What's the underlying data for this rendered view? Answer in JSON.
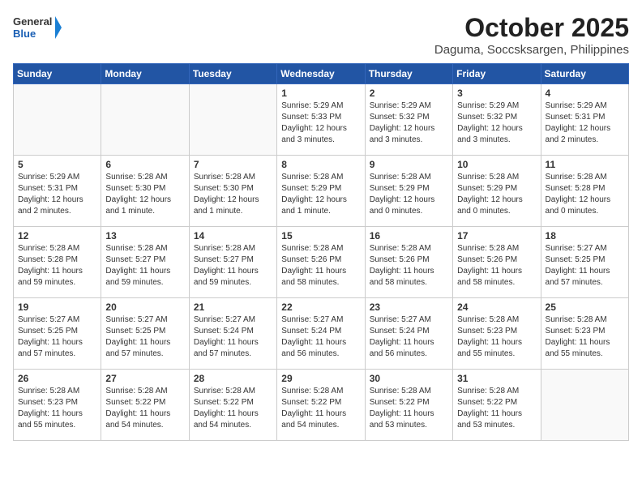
{
  "logo": {
    "text_general": "General",
    "text_blue": "Blue"
  },
  "header": {
    "month": "October 2025",
    "location": "Daguma, Soccsksargen, Philippines"
  },
  "weekdays": [
    "Sunday",
    "Monday",
    "Tuesday",
    "Wednesday",
    "Thursday",
    "Friday",
    "Saturday"
  ],
  "weeks": [
    [
      {
        "day": "",
        "sunrise": "",
        "sunset": "",
        "daylight": ""
      },
      {
        "day": "",
        "sunrise": "",
        "sunset": "",
        "daylight": ""
      },
      {
        "day": "",
        "sunrise": "",
        "sunset": "",
        "daylight": ""
      },
      {
        "day": "1",
        "sunrise": "Sunrise: 5:29 AM",
        "sunset": "Sunset: 5:33 PM",
        "daylight": "Daylight: 12 hours and 3 minutes."
      },
      {
        "day": "2",
        "sunrise": "Sunrise: 5:29 AM",
        "sunset": "Sunset: 5:32 PM",
        "daylight": "Daylight: 12 hours and 3 minutes."
      },
      {
        "day": "3",
        "sunrise": "Sunrise: 5:29 AM",
        "sunset": "Sunset: 5:32 PM",
        "daylight": "Daylight: 12 hours and 3 minutes."
      },
      {
        "day": "4",
        "sunrise": "Sunrise: 5:29 AM",
        "sunset": "Sunset: 5:31 PM",
        "daylight": "Daylight: 12 hours and 2 minutes."
      }
    ],
    [
      {
        "day": "5",
        "sunrise": "Sunrise: 5:29 AM",
        "sunset": "Sunset: 5:31 PM",
        "daylight": "Daylight: 12 hours and 2 minutes."
      },
      {
        "day": "6",
        "sunrise": "Sunrise: 5:28 AM",
        "sunset": "Sunset: 5:30 PM",
        "daylight": "Daylight: 12 hours and 1 minute."
      },
      {
        "day": "7",
        "sunrise": "Sunrise: 5:28 AM",
        "sunset": "Sunset: 5:30 PM",
        "daylight": "Daylight: 12 hours and 1 minute."
      },
      {
        "day": "8",
        "sunrise": "Sunrise: 5:28 AM",
        "sunset": "Sunset: 5:29 PM",
        "daylight": "Daylight: 12 hours and 1 minute."
      },
      {
        "day": "9",
        "sunrise": "Sunrise: 5:28 AM",
        "sunset": "Sunset: 5:29 PM",
        "daylight": "Daylight: 12 hours and 0 minutes."
      },
      {
        "day": "10",
        "sunrise": "Sunrise: 5:28 AM",
        "sunset": "Sunset: 5:29 PM",
        "daylight": "Daylight: 12 hours and 0 minutes."
      },
      {
        "day": "11",
        "sunrise": "Sunrise: 5:28 AM",
        "sunset": "Sunset: 5:28 PM",
        "daylight": "Daylight: 12 hours and 0 minutes."
      }
    ],
    [
      {
        "day": "12",
        "sunrise": "Sunrise: 5:28 AM",
        "sunset": "Sunset: 5:28 PM",
        "daylight": "Daylight: 11 hours and 59 minutes."
      },
      {
        "day": "13",
        "sunrise": "Sunrise: 5:28 AM",
        "sunset": "Sunset: 5:27 PM",
        "daylight": "Daylight: 11 hours and 59 minutes."
      },
      {
        "day": "14",
        "sunrise": "Sunrise: 5:28 AM",
        "sunset": "Sunset: 5:27 PM",
        "daylight": "Daylight: 11 hours and 59 minutes."
      },
      {
        "day": "15",
        "sunrise": "Sunrise: 5:28 AM",
        "sunset": "Sunset: 5:26 PM",
        "daylight": "Daylight: 11 hours and 58 minutes."
      },
      {
        "day": "16",
        "sunrise": "Sunrise: 5:28 AM",
        "sunset": "Sunset: 5:26 PM",
        "daylight": "Daylight: 11 hours and 58 minutes."
      },
      {
        "day": "17",
        "sunrise": "Sunrise: 5:28 AM",
        "sunset": "Sunset: 5:26 PM",
        "daylight": "Daylight: 11 hours and 58 minutes."
      },
      {
        "day": "18",
        "sunrise": "Sunrise: 5:27 AM",
        "sunset": "Sunset: 5:25 PM",
        "daylight": "Daylight: 11 hours and 57 minutes."
      }
    ],
    [
      {
        "day": "19",
        "sunrise": "Sunrise: 5:27 AM",
        "sunset": "Sunset: 5:25 PM",
        "daylight": "Daylight: 11 hours and 57 minutes."
      },
      {
        "day": "20",
        "sunrise": "Sunrise: 5:27 AM",
        "sunset": "Sunset: 5:25 PM",
        "daylight": "Daylight: 11 hours and 57 minutes."
      },
      {
        "day": "21",
        "sunrise": "Sunrise: 5:27 AM",
        "sunset": "Sunset: 5:24 PM",
        "daylight": "Daylight: 11 hours and 57 minutes."
      },
      {
        "day": "22",
        "sunrise": "Sunrise: 5:27 AM",
        "sunset": "Sunset: 5:24 PM",
        "daylight": "Daylight: 11 hours and 56 minutes."
      },
      {
        "day": "23",
        "sunrise": "Sunrise: 5:27 AM",
        "sunset": "Sunset: 5:24 PM",
        "daylight": "Daylight: 11 hours and 56 minutes."
      },
      {
        "day": "24",
        "sunrise": "Sunrise: 5:28 AM",
        "sunset": "Sunset: 5:23 PM",
        "daylight": "Daylight: 11 hours and 55 minutes."
      },
      {
        "day": "25",
        "sunrise": "Sunrise: 5:28 AM",
        "sunset": "Sunset: 5:23 PM",
        "daylight": "Daylight: 11 hours and 55 minutes."
      }
    ],
    [
      {
        "day": "26",
        "sunrise": "Sunrise: 5:28 AM",
        "sunset": "Sunset: 5:23 PM",
        "daylight": "Daylight: 11 hours and 55 minutes."
      },
      {
        "day": "27",
        "sunrise": "Sunrise: 5:28 AM",
        "sunset": "Sunset: 5:22 PM",
        "daylight": "Daylight: 11 hours and 54 minutes."
      },
      {
        "day": "28",
        "sunrise": "Sunrise: 5:28 AM",
        "sunset": "Sunset: 5:22 PM",
        "daylight": "Daylight: 11 hours and 54 minutes."
      },
      {
        "day": "29",
        "sunrise": "Sunrise: 5:28 AM",
        "sunset": "Sunset: 5:22 PM",
        "daylight": "Daylight: 11 hours and 54 minutes."
      },
      {
        "day": "30",
        "sunrise": "Sunrise: 5:28 AM",
        "sunset": "Sunset: 5:22 PM",
        "daylight": "Daylight: 11 hours and 53 minutes."
      },
      {
        "day": "31",
        "sunrise": "Sunrise: 5:28 AM",
        "sunset": "Sunset: 5:22 PM",
        "daylight": "Daylight: 11 hours and 53 minutes."
      },
      {
        "day": "",
        "sunrise": "",
        "sunset": "",
        "daylight": ""
      }
    ]
  ]
}
